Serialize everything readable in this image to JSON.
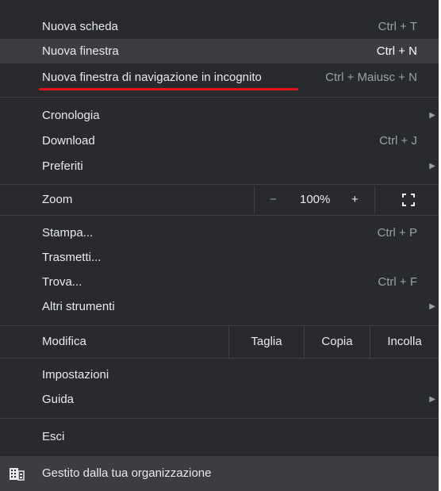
{
  "menu": {
    "new_tab": {
      "label": "Nuova scheda",
      "shortcut": "Ctrl + T"
    },
    "new_window": {
      "label": "Nuova finestra",
      "shortcut": "Ctrl + N"
    },
    "incognito": {
      "label": "Nuova finestra di navigazione in incognito",
      "shortcut": "Ctrl + Maiusc + N"
    },
    "history": {
      "label": "Cronologia"
    },
    "downloads": {
      "label": "Download",
      "shortcut": "Ctrl + J"
    },
    "bookmarks": {
      "label": "Preferiti"
    },
    "zoom": {
      "label": "Zoom",
      "minus": "−",
      "value": "100%",
      "plus": "+"
    },
    "print": {
      "label": "Stampa...",
      "shortcut": "Ctrl + P"
    },
    "cast": {
      "label": "Trasmetti..."
    },
    "find": {
      "label": "Trova...",
      "shortcut": "Ctrl + F"
    },
    "more_tools": {
      "label": "Altri strumenti"
    },
    "edit": {
      "label": "Modifica",
      "cut": "Taglia",
      "copy": "Copia",
      "paste": "Incolla"
    },
    "settings": {
      "label": "Impostazioni"
    },
    "help": {
      "label": "Guida"
    },
    "exit": {
      "label": "Esci"
    }
  },
  "footer": {
    "label": "Gestito dalla tua organizzazione",
    "icon": "building-icon"
  },
  "colors": {
    "background": "#292a2d",
    "highlight": "#3c3d41",
    "annotation": "#e0141b"
  }
}
